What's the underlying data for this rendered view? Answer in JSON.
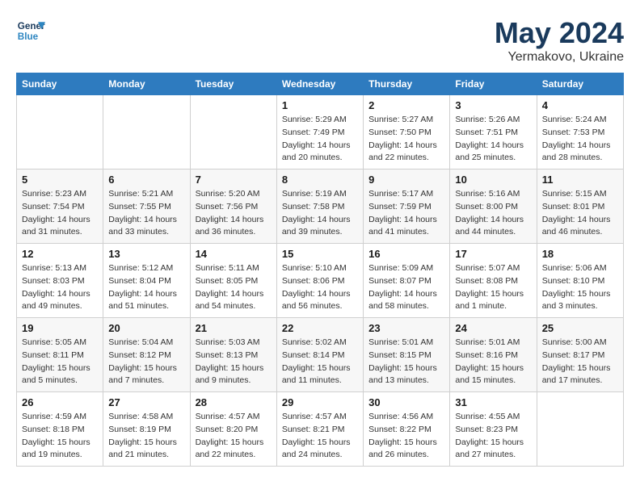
{
  "logo": {
    "line1": "General",
    "line2": "Blue"
  },
  "header": {
    "month": "May 2024",
    "location": "Yermakovo, Ukraine"
  },
  "weekdays": [
    "Sunday",
    "Monday",
    "Tuesday",
    "Wednesday",
    "Thursday",
    "Friday",
    "Saturday"
  ],
  "weeks": [
    [
      {
        "day": "",
        "info": ""
      },
      {
        "day": "",
        "info": ""
      },
      {
        "day": "",
        "info": ""
      },
      {
        "day": "1",
        "info": "Sunrise: 5:29 AM\nSunset: 7:49 PM\nDaylight: 14 hours\nand 20 minutes."
      },
      {
        "day": "2",
        "info": "Sunrise: 5:27 AM\nSunset: 7:50 PM\nDaylight: 14 hours\nand 22 minutes."
      },
      {
        "day": "3",
        "info": "Sunrise: 5:26 AM\nSunset: 7:51 PM\nDaylight: 14 hours\nand 25 minutes."
      },
      {
        "day": "4",
        "info": "Sunrise: 5:24 AM\nSunset: 7:53 PM\nDaylight: 14 hours\nand 28 minutes."
      }
    ],
    [
      {
        "day": "5",
        "info": "Sunrise: 5:23 AM\nSunset: 7:54 PM\nDaylight: 14 hours\nand 31 minutes."
      },
      {
        "day": "6",
        "info": "Sunrise: 5:21 AM\nSunset: 7:55 PM\nDaylight: 14 hours\nand 33 minutes."
      },
      {
        "day": "7",
        "info": "Sunrise: 5:20 AM\nSunset: 7:56 PM\nDaylight: 14 hours\nand 36 minutes."
      },
      {
        "day": "8",
        "info": "Sunrise: 5:19 AM\nSunset: 7:58 PM\nDaylight: 14 hours\nand 39 minutes."
      },
      {
        "day": "9",
        "info": "Sunrise: 5:17 AM\nSunset: 7:59 PM\nDaylight: 14 hours\nand 41 minutes."
      },
      {
        "day": "10",
        "info": "Sunrise: 5:16 AM\nSunset: 8:00 PM\nDaylight: 14 hours\nand 44 minutes."
      },
      {
        "day": "11",
        "info": "Sunrise: 5:15 AM\nSunset: 8:01 PM\nDaylight: 14 hours\nand 46 minutes."
      }
    ],
    [
      {
        "day": "12",
        "info": "Sunrise: 5:13 AM\nSunset: 8:03 PM\nDaylight: 14 hours\nand 49 minutes."
      },
      {
        "day": "13",
        "info": "Sunrise: 5:12 AM\nSunset: 8:04 PM\nDaylight: 14 hours\nand 51 minutes."
      },
      {
        "day": "14",
        "info": "Sunrise: 5:11 AM\nSunset: 8:05 PM\nDaylight: 14 hours\nand 54 minutes."
      },
      {
        "day": "15",
        "info": "Sunrise: 5:10 AM\nSunset: 8:06 PM\nDaylight: 14 hours\nand 56 minutes."
      },
      {
        "day": "16",
        "info": "Sunrise: 5:09 AM\nSunset: 8:07 PM\nDaylight: 14 hours\nand 58 minutes."
      },
      {
        "day": "17",
        "info": "Sunrise: 5:07 AM\nSunset: 8:08 PM\nDaylight: 15 hours\nand 1 minute."
      },
      {
        "day": "18",
        "info": "Sunrise: 5:06 AM\nSunset: 8:10 PM\nDaylight: 15 hours\nand 3 minutes."
      }
    ],
    [
      {
        "day": "19",
        "info": "Sunrise: 5:05 AM\nSunset: 8:11 PM\nDaylight: 15 hours\nand 5 minutes."
      },
      {
        "day": "20",
        "info": "Sunrise: 5:04 AM\nSunset: 8:12 PM\nDaylight: 15 hours\nand 7 minutes."
      },
      {
        "day": "21",
        "info": "Sunrise: 5:03 AM\nSunset: 8:13 PM\nDaylight: 15 hours\nand 9 minutes."
      },
      {
        "day": "22",
        "info": "Sunrise: 5:02 AM\nSunset: 8:14 PM\nDaylight: 15 hours\nand 11 minutes."
      },
      {
        "day": "23",
        "info": "Sunrise: 5:01 AM\nSunset: 8:15 PM\nDaylight: 15 hours\nand 13 minutes."
      },
      {
        "day": "24",
        "info": "Sunrise: 5:01 AM\nSunset: 8:16 PM\nDaylight: 15 hours\nand 15 minutes."
      },
      {
        "day": "25",
        "info": "Sunrise: 5:00 AM\nSunset: 8:17 PM\nDaylight: 15 hours\nand 17 minutes."
      }
    ],
    [
      {
        "day": "26",
        "info": "Sunrise: 4:59 AM\nSunset: 8:18 PM\nDaylight: 15 hours\nand 19 minutes."
      },
      {
        "day": "27",
        "info": "Sunrise: 4:58 AM\nSunset: 8:19 PM\nDaylight: 15 hours\nand 21 minutes."
      },
      {
        "day": "28",
        "info": "Sunrise: 4:57 AM\nSunset: 8:20 PM\nDaylight: 15 hours\nand 22 minutes."
      },
      {
        "day": "29",
        "info": "Sunrise: 4:57 AM\nSunset: 8:21 PM\nDaylight: 15 hours\nand 24 minutes."
      },
      {
        "day": "30",
        "info": "Sunrise: 4:56 AM\nSunset: 8:22 PM\nDaylight: 15 hours\nand 26 minutes."
      },
      {
        "day": "31",
        "info": "Sunrise: 4:55 AM\nSunset: 8:23 PM\nDaylight: 15 hours\nand 27 minutes."
      },
      {
        "day": "",
        "info": ""
      }
    ]
  ]
}
